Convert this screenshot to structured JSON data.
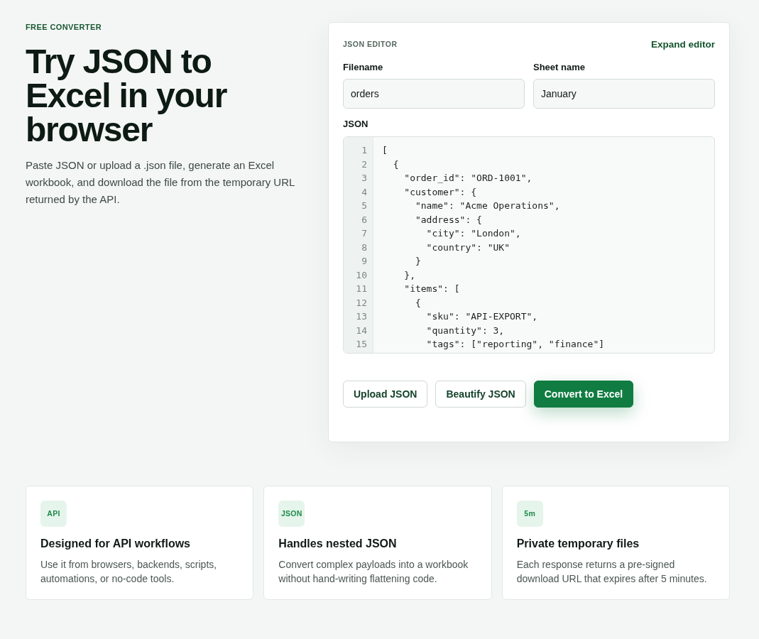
{
  "hero": {
    "eyebrow": "FREE CONVERTER",
    "headline": "Try JSON to Excel in your browser",
    "intro": "Paste JSON or upload a .json file, generate an Excel workbook, and download the file from the temporary URL returned by the API."
  },
  "editor": {
    "heading": "JSON EDITOR",
    "expand_link": "Expand editor",
    "fields": [
      {
        "label": "Filename",
        "value": "orders"
      },
      {
        "label": "Sheet name",
        "value": "January"
      }
    ],
    "json_label": "JSON",
    "code_lines": [
      {
        "number": "1",
        "text": "["
      },
      {
        "number": "2",
        "text": "  {"
      },
      {
        "number": "3",
        "text": "    \"order_id\": \"ORD-1001\","
      },
      {
        "number": "4",
        "text": "    \"customer\": {"
      },
      {
        "number": "5",
        "text": "      \"name\": \"Acme Operations\","
      },
      {
        "number": "6",
        "text": "      \"address\": {"
      },
      {
        "number": "7",
        "text": "        \"city\": \"London\","
      },
      {
        "number": "8",
        "text": "        \"country\": \"UK\""
      },
      {
        "number": "9",
        "text": "      }"
      },
      {
        "number": "10",
        "text": "    },"
      },
      {
        "number": "11",
        "text": "    \"items\": ["
      },
      {
        "number": "12",
        "text": "      {"
      },
      {
        "number": "13",
        "text": "        \"sku\": \"API-EXPORT\","
      },
      {
        "number": "14",
        "text": "        \"quantity\": 3,"
      },
      {
        "number": "15",
        "text": "        \"tags\": [\"reporting\", \"finance\"]"
      }
    ],
    "buttons": [
      {
        "label": "Upload JSON",
        "kind": "secondary"
      },
      {
        "label": "Beautify JSON",
        "kind": "secondary"
      },
      {
        "label": "Convert to Excel",
        "kind": "primary"
      }
    ]
  },
  "features": [
    {
      "badge": "API",
      "title": "Designed for API workflows",
      "description": "Use it from browsers, backends, scripts, automations, or no-code tools."
    },
    {
      "badge": "JSON",
      "title": "Handles nested JSON",
      "description": "Convert complex payloads into a workbook without hand-writing flattening code."
    },
    {
      "badge": "5m",
      "title": "Private temporary files",
      "description": "Each response returns a pre-signed download URL that expires after 5 minutes."
    }
  ]
}
